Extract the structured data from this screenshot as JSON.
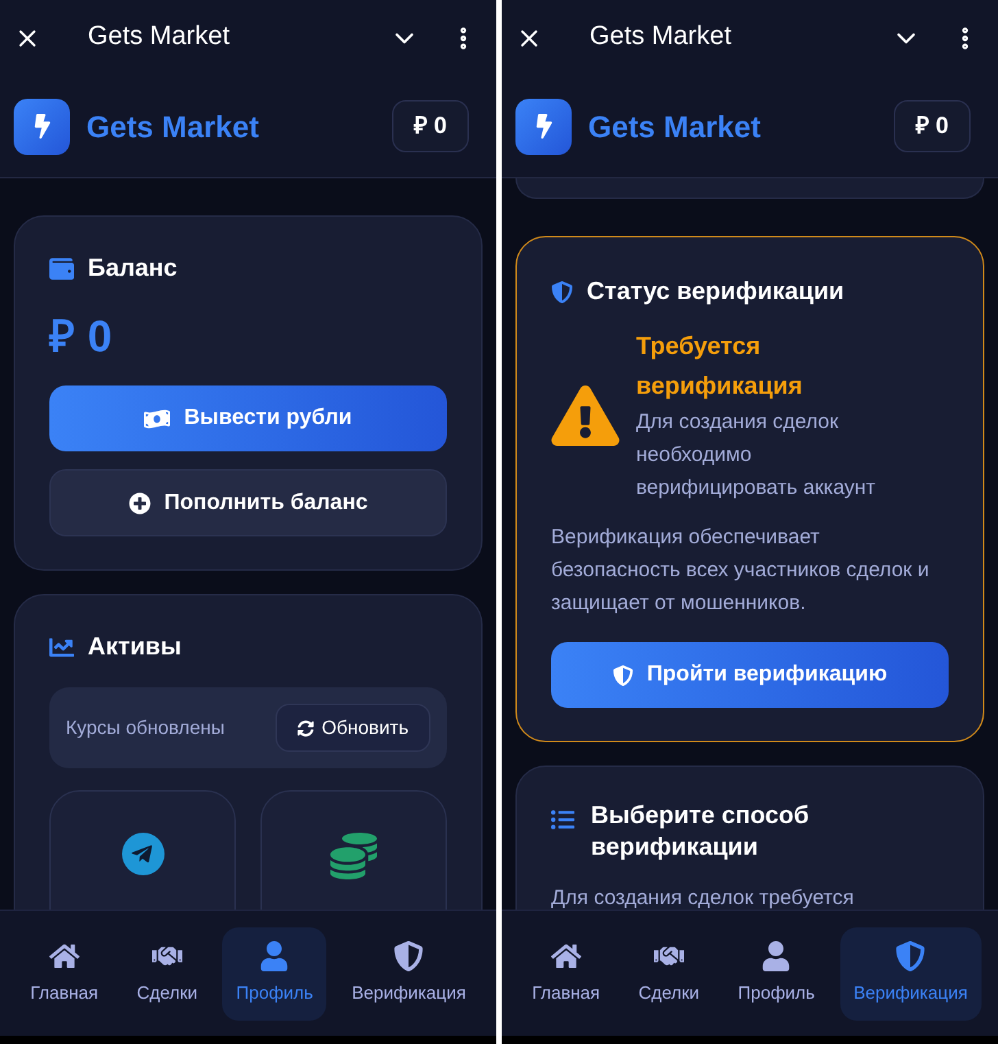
{
  "screens": [
    {
      "top_bar": {
        "title": "Gets Market"
      },
      "header": {
        "brand": "Gets Market",
        "balance": "₽ 0"
      },
      "cards": [
        {
          "kind": "balance",
          "title": "Баланс",
          "amount": "₽ 0",
          "buttons": [
            {
              "label": "Вывести рубли",
              "kind": "primary"
            },
            {
              "label": "Пополнить баланс",
              "kind": "secondary"
            }
          ]
        },
        {
          "kind": "assets",
          "title": "Активы",
          "status": "Курсы обновлены",
          "refresh": "Обновить",
          "tiles": [
            {
              "kind": "telegram"
            },
            {
              "kind": "coins"
            }
          ]
        }
      ],
      "nav": [
        {
          "label": "Главная",
          "selected": false
        },
        {
          "label": "Сделки",
          "selected": false
        },
        {
          "label": "Профиль",
          "selected": true
        },
        {
          "label": "Верификация",
          "selected": false
        }
      ]
    },
    {
      "top_bar": {
        "title": "Gets Market"
      },
      "header": {
        "brand": "Gets Market",
        "balance": "₽ 0"
      },
      "cards": [
        {
          "kind": "stub"
        },
        {
          "kind": "verification_status",
          "title": "Статус верификации",
          "alert_title": "Требуется верификация",
          "alert_text": "Для создания сделок необходимо верифицировать аккаунт",
          "body": "Верификация обеспечивает безопасность всех участников сделок и защищает от мошенников.",
          "button": "Пройти верификацию"
        },
        {
          "kind": "method",
          "title": "Выберите способ верификации",
          "text": "Для создания сделок требуется"
        }
      ],
      "nav": [
        {
          "label": "Главная",
          "selected": false
        },
        {
          "label": "Сделки",
          "selected": false
        },
        {
          "label": "Профиль",
          "selected": false
        },
        {
          "label": "Верификация",
          "selected": true
        }
      ]
    }
  ]
}
